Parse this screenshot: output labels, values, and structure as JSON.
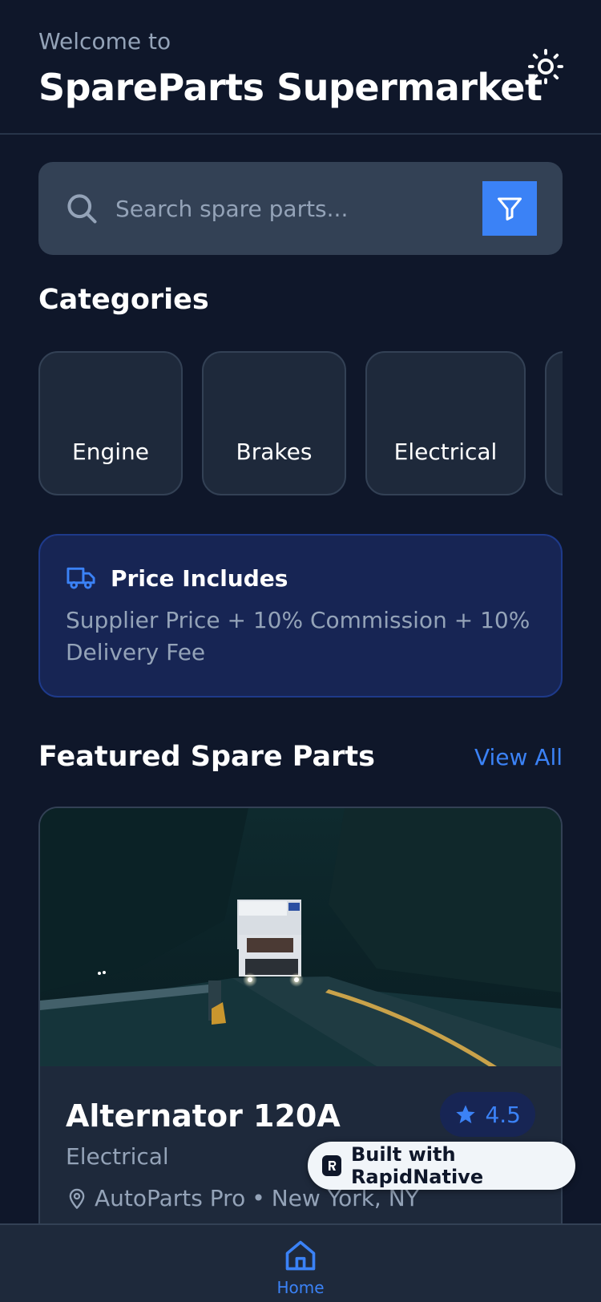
{
  "header": {
    "welcome": "Welcome to",
    "title": "SpareParts Supermarket",
    "theme_icon": "sun-icon"
  },
  "search": {
    "placeholder": "Search spare parts...",
    "icon": "search-icon",
    "filter_icon": "filter-icon"
  },
  "categories": {
    "title": "Categories",
    "items": [
      {
        "label": "Engine"
      },
      {
        "label": "Brakes"
      },
      {
        "label": "Electrical"
      },
      {
        "label": ""
      }
    ]
  },
  "price_info": {
    "icon": "truck-icon",
    "title": "Price Includes",
    "text": "Supplier Price + 10% Commission + 10% Delivery Fee"
  },
  "featured": {
    "title": "Featured Spare Parts",
    "view_all": "View All",
    "products": [
      {
        "name": "Alternator 120A",
        "category": "Electrical",
        "rating": "4.5",
        "supplier": "AutoParts Pro",
        "separator": "•",
        "location": "New York, NY"
      }
    ]
  },
  "badge": {
    "label": "Built with RapidNative"
  },
  "nav": {
    "home_label": "Home",
    "home_icon": "home-icon"
  },
  "colors": {
    "background": "#0f172a",
    "card": "#1e293b",
    "accent": "#3b82f6",
    "muted_text": "#94a3b8"
  }
}
